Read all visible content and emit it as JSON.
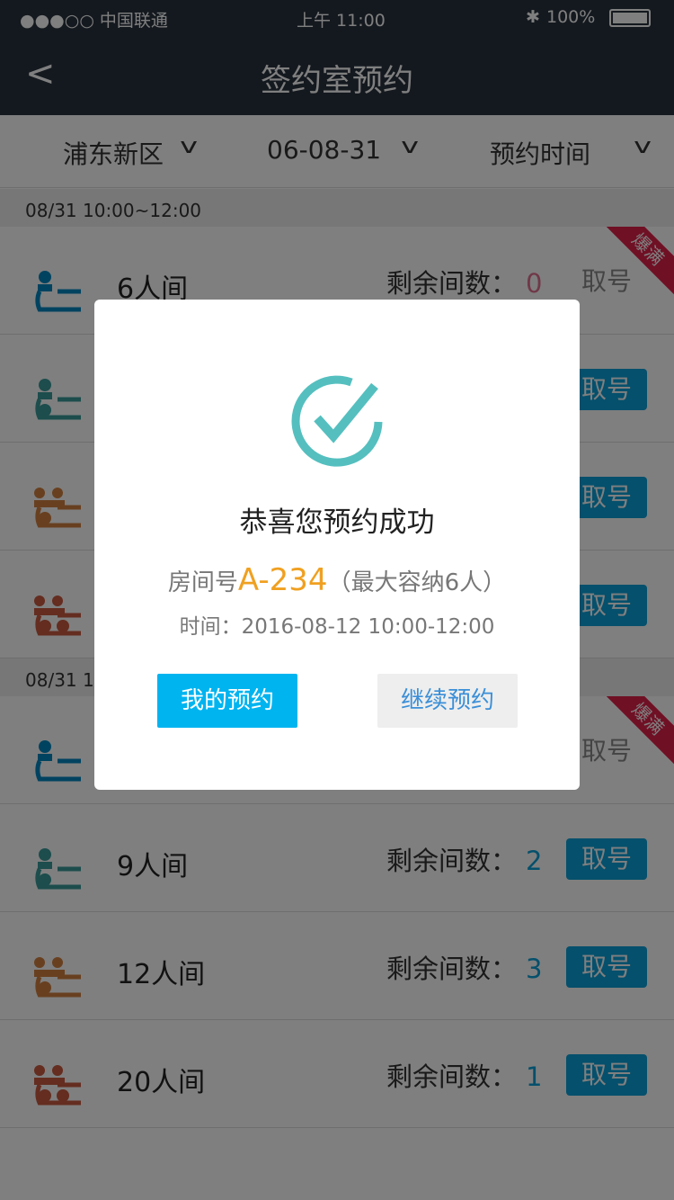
{
  "status_bar": {
    "carrier": "●●●○○ 中国联通",
    "time": "上午 11:00",
    "battery": "100%"
  },
  "nav": {
    "back_icon": "chevron-left-icon",
    "title": "签约室预约"
  },
  "filters": [
    {
      "label": "浦东新区"
    },
    {
      "label": "06-08-31"
    },
    {
      "label": "预约时间"
    }
  ],
  "remaining_label": "剩余间数：",
  "take_label": "取号",
  "full_badge": "爆满",
  "groups": [
    {
      "header": "08/31 10:00~12:00",
      "rows": [
        {
          "name": "6人间",
          "count": "0",
          "full": true,
          "icon_color": "#0086c0"
        },
        {
          "name": "",
          "count": "",
          "full": false,
          "icon_color": "#3a9a9a"
        },
        {
          "name": "",
          "count": "",
          "full": false,
          "icon_color": "#d08040"
        },
        {
          "name": "",
          "count": "",
          "full": false,
          "icon_color": "#c85a40"
        }
      ]
    },
    {
      "header": "08/31 1",
      "rows": [
        {
          "name": "",
          "count": "",
          "full": true,
          "icon_color": "#0086c0"
        },
        {
          "name": "9人间",
          "count": "2",
          "full": false,
          "icon_color": "#3a9a9a"
        },
        {
          "name": "12人间",
          "count": "3",
          "full": false,
          "icon_color": "#d08040"
        },
        {
          "name": "20人间",
          "count": "1",
          "full": false,
          "icon_color": "#c85a40"
        }
      ]
    }
  ],
  "modal": {
    "title": "恭喜您预约成功",
    "room_label": "房间号",
    "room_code": "A-234",
    "capacity": "（最大容纳6人）",
    "time": "时间：2016-08-12  10:00-12:00",
    "my_booking": "我的预约",
    "continue": "继续预约",
    "check_color": "#55bfbf"
  }
}
